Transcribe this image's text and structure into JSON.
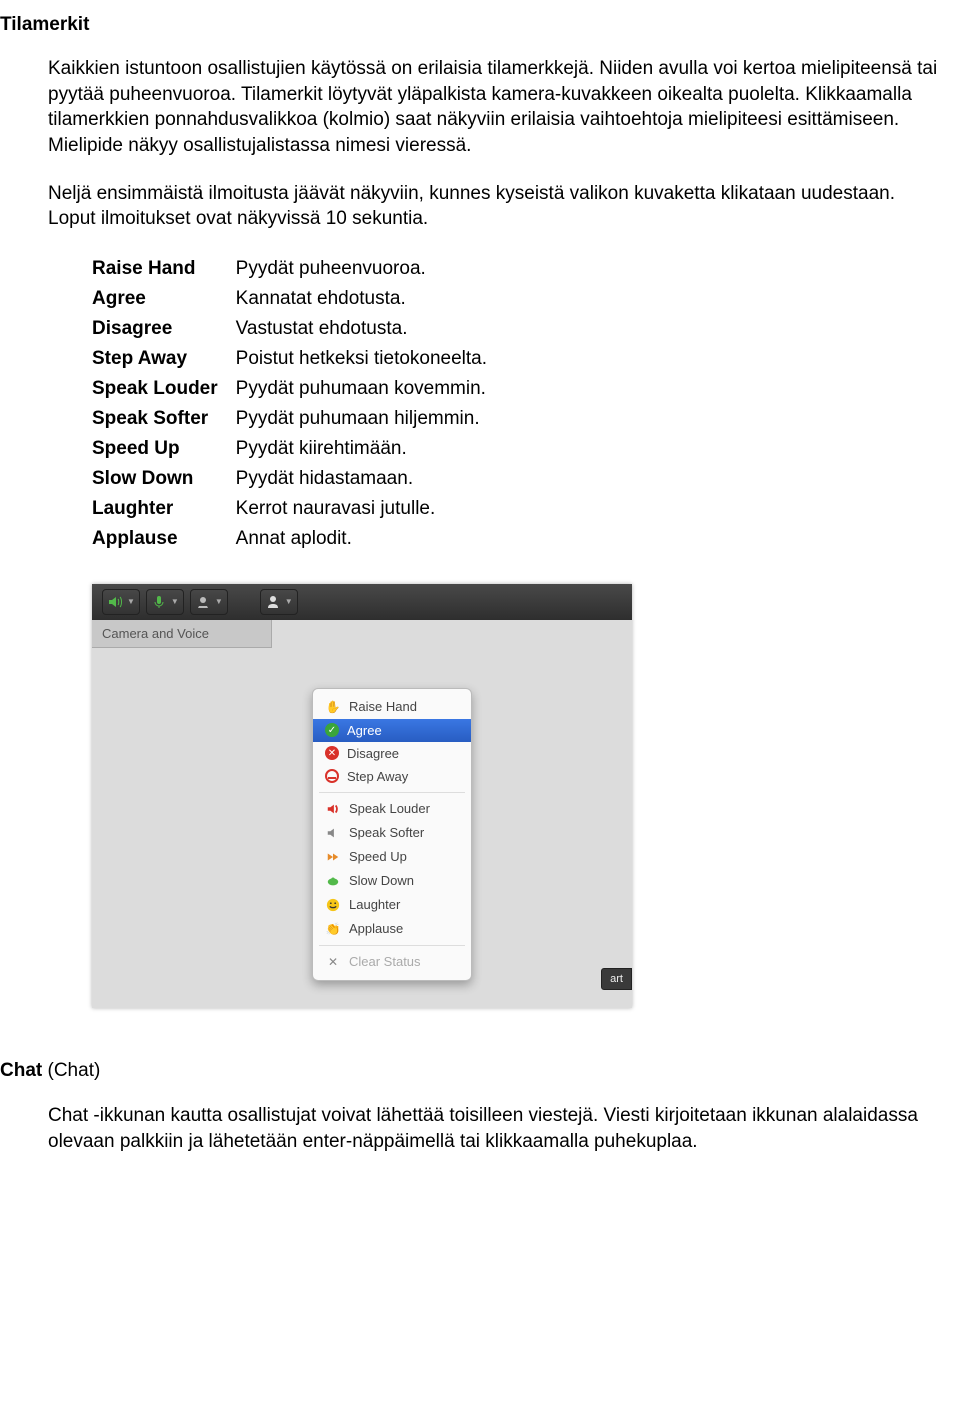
{
  "title": "Tilamerkit",
  "para1": "Kaikkien istuntoon osallistujien käytössä on erilaisia tilamerkkejä. Niiden avulla voi kertoa mielipiteensä tai pyytää puheenvuoroa. Tilamerkit löytyvät yläpalkista kamera-kuvakkeen oikealta puolelta. Klikkaamalla tilamerkkien ponnahdusvalikkoa (kolmio) saat näkyviin erilaisia vaihtoehtoja mielipiteesi esittämiseen. Mielipide näkyy osallistujalistassa nimesi vieressä.",
  "para2": "Neljä ensimmäistä ilmoitusta jäävät näkyviin, kunnes kyseistä valikon kuvaketta klikataan uudestaan. Loput ilmoitukset ovat näkyvissä 10 sekuntia.",
  "defs": [
    {
      "term": "Raise Hand",
      "desc": "Pyydät puheenvuoroa."
    },
    {
      "term": "Agree",
      "desc": "Kannatat ehdotusta."
    },
    {
      "term": "Disagree",
      "desc": "Vastustat ehdotusta."
    },
    {
      "term": "Step Away",
      "desc": "Poistut hetkeksi tietokoneelta."
    },
    {
      "term": "Speak Louder",
      "desc": "Pyydät puhumaan kovemmin."
    },
    {
      "term": "Speak Softer",
      "desc": "Pyydät puhumaan hiljemmin."
    },
    {
      "term": "Speed Up",
      "desc": "Pyydät kiirehtimään."
    },
    {
      "term": "Slow Down",
      "desc": "Pyydät hidastamaan."
    },
    {
      "term": "Laughter",
      "desc": "Kerrot nauravasi jutulle."
    },
    {
      "term": "Applause",
      "desc": "Annat aplodit."
    }
  ],
  "shot": {
    "panel_label": "Camera and Voice",
    "start_fragment": "art",
    "menu": {
      "items": [
        {
          "label": "Raise Hand",
          "icon": "raise-hand-icon"
        },
        {
          "label": "Agree",
          "icon": "agree-icon",
          "selected": true
        },
        {
          "label": "Disagree",
          "icon": "disagree-icon"
        },
        {
          "label": "Step Away",
          "icon": "step-away-icon"
        }
      ],
      "items2": [
        {
          "label": "Speak Louder",
          "icon": "speak-louder-icon"
        },
        {
          "label": "Speak Softer",
          "icon": "speak-softer-icon"
        },
        {
          "label": "Speed Up",
          "icon": "speed-up-icon"
        },
        {
          "label": "Slow Down",
          "icon": "slow-down-icon"
        },
        {
          "label": "Laughter",
          "icon": "laughter-icon"
        },
        {
          "label": "Applause",
          "icon": "applause-icon"
        }
      ],
      "clear": "Clear Status"
    }
  },
  "chat": {
    "heading_bold": "Chat",
    "heading_rest": " (Chat)",
    "para": "Chat -ikkunan kautta osallistujat voivat lähettää toisilleen viestejä. Viesti kirjoitetaan ikkunan alalaidassa olevaan palkkiin ja lähetetään enter-näppäimellä tai klikkaamalla puhekuplaa."
  }
}
